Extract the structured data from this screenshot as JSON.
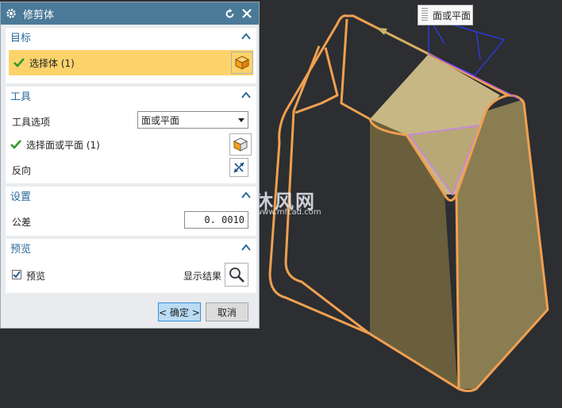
{
  "dialog": {
    "title": "修剪体",
    "sections": {
      "target": {
        "header": "目标",
        "select_body_label": "选择体 (1)"
      },
      "tool": {
        "header": "工具",
        "tool_option_label": "工具选项",
        "tool_option_value": "面或平面",
        "select_face_label": "选择面或平面 (1)",
        "reverse_label": "反向"
      },
      "settings": {
        "header": "设置",
        "tolerance_label": "公差",
        "tolerance_value": "0. 0010"
      },
      "preview": {
        "header": "预览",
        "preview_label": "预览",
        "preview_checked": true,
        "show_result_label": "显示结果"
      }
    },
    "buttons": {
      "ok": "< 确定 >",
      "cancel": "取消"
    }
  },
  "viewport": {
    "tooltip": "面或平面",
    "watermark_main": "沐风网",
    "watermark_url": "www.mfcad.com"
  },
  "colors": {
    "title_bar": "#4a7a98",
    "section_header": "#2a6b9c",
    "selection_highlight": "#fcd36b",
    "edge_highlight": "#f0a050",
    "part_face": "#c7b784",
    "viewport_bg": "#2c2e31"
  },
  "icons": [
    "gear-icon",
    "reset-icon",
    "close-icon",
    "chevron-up-icon",
    "check-icon",
    "cube-icon",
    "reverse-direction-icon",
    "magnifier-icon",
    "dropdown-arrow-icon"
  ]
}
